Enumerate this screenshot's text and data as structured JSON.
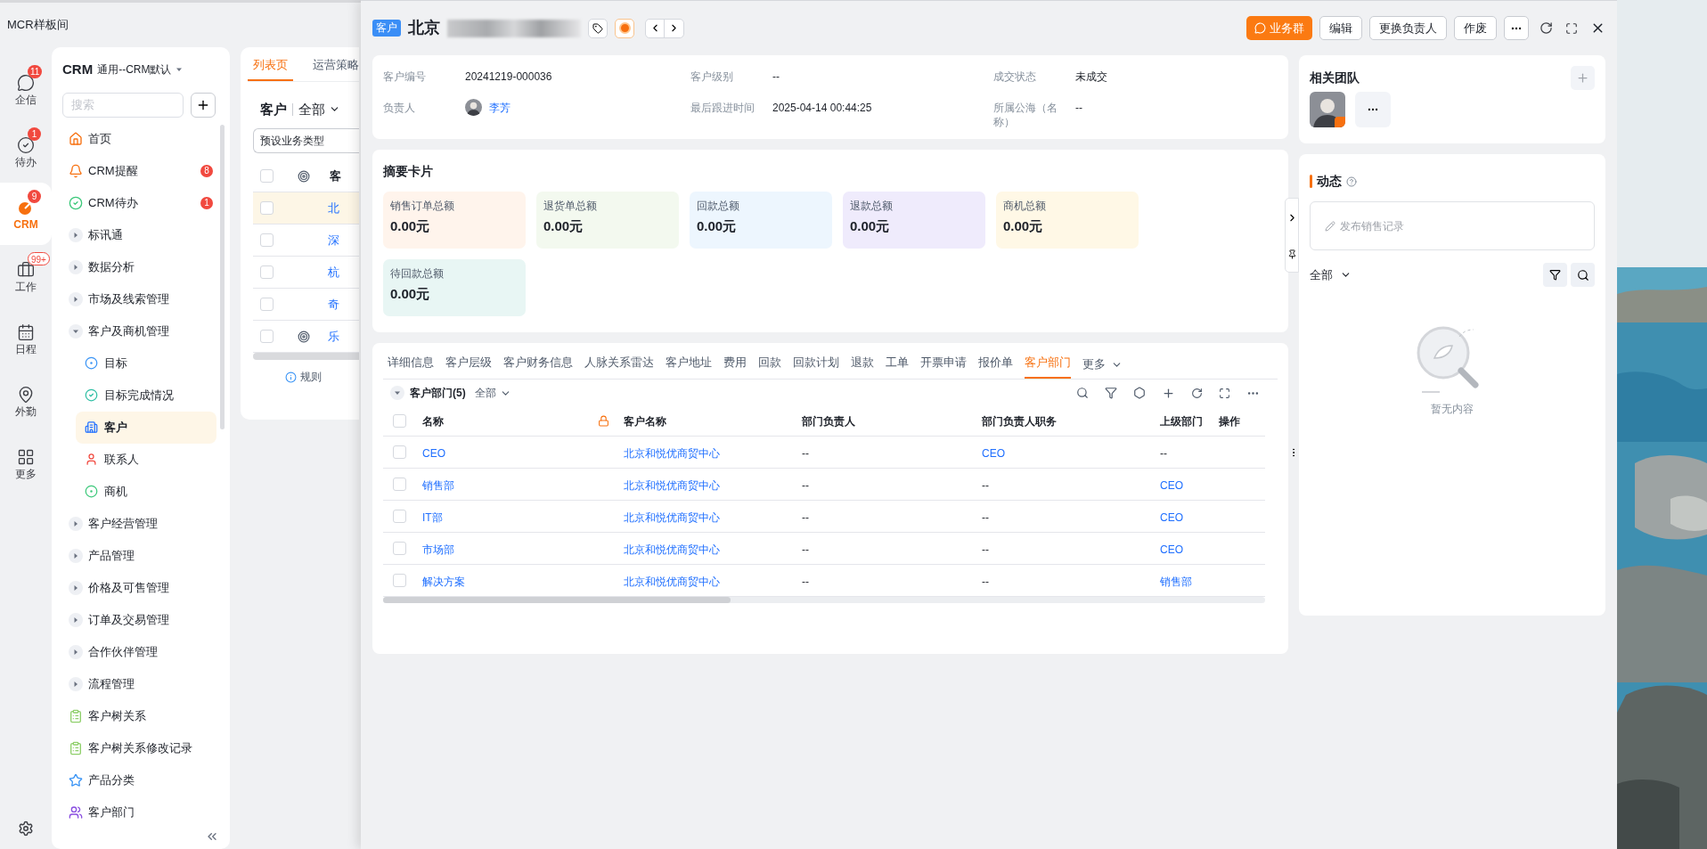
{
  "app_title": "MCR样板间",
  "rail": [
    {
      "label": "企信",
      "badge": "11",
      "badge_outlined": false,
      "selected": false
    },
    {
      "label": "待办",
      "badge": "1",
      "badge_outlined": false,
      "selected": false
    },
    {
      "label": "CRM",
      "badge": "9",
      "badge_outlined": false,
      "selected": true
    },
    {
      "label": "工作",
      "badge": "99+",
      "badge_outlined": true,
      "selected": false
    },
    {
      "label": "日程",
      "selected": false
    },
    {
      "label": "外勤",
      "selected": false
    },
    {
      "label": "更多",
      "selected": false
    }
  ],
  "nav": {
    "title": "CRM",
    "subtitle": "通用--CRM默认",
    "search_placeholder": "搜索",
    "items": [
      {
        "kind": "link",
        "label": "首页",
        "selected": false
      },
      {
        "kind": "link",
        "label": "CRM提醒",
        "badge": "8",
        "selected": false
      },
      {
        "kind": "link",
        "label": "CRM待办",
        "badge": "1",
        "selected": false
      },
      {
        "kind": "group",
        "label": "标讯通",
        "expanded": false,
        "selected": false
      },
      {
        "kind": "group",
        "label": "数据分析",
        "expanded": false,
        "selected": false
      },
      {
        "kind": "group",
        "label": "市场及线索管理",
        "expanded": false,
        "selected": false
      },
      {
        "kind": "group",
        "label": "客户及商机管理",
        "expanded": true,
        "selected": false,
        "children": [
          {
            "label": "目标",
            "selected": false
          },
          {
            "label": "目标完成情况",
            "selected": false
          },
          {
            "label": "客户",
            "selected": true
          },
          {
            "label": "联系人",
            "selected": false
          },
          {
            "label": "商机",
            "selected": false
          }
        ]
      },
      {
        "kind": "group",
        "label": "客户经营管理",
        "expanded": false,
        "selected": false
      },
      {
        "kind": "group",
        "label": "产品管理",
        "expanded": false,
        "selected": false
      },
      {
        "kind": "group",
        "label": "价格及可售管理",
        "expanded": false,
        "selected": false
      },
      {
        "kind": "group",
        "label": "订单及交易管理",
        "expanded": false,
        "selected": false
      },
      {
        "kind": "group",
        "label": "合作伙伴管理",
        "expanded": false,
        "selected": false
      },
      {
        "kind": "group",
        "label": "流程管理",
        "expanded": false,
        "selected": false
      },
      {
        "kind": "link",
        "label": "客户树关系",
        "selected": false
      },
      {
        "kind": "link",
        "label": "客户树关系修改记录",
        "selected": false
      },
      {
        "kind": "link",
        "label": "产品分类",
        "selected": false
      },
      {
        "kind": "link",
        "label": "客户部门",
        "selected": false
      }
    ]
  },
  "list_panel": {
    "tabs": [
      {
        "label": "列表页",
        "selected": true
      },
      {
        "label": "运营策略",
        "selected": false
      }
    ],
    "all_checked": false,
    "object": "客户",
    "scope": "全部",
    "type_filter": "预设业务类型",
    "header_column": "客",
    "rows": [
      {
        "name": "北",
        "selected": true,
        "checked": false,
        "marked": false
      },
      {
        "name": "深",
        "selected": false,
        "checked": false,
        "marked": false
      },
      {
        "name": "杭",
        "selected": false,
        "checked": false,
        "marked": false
      },
      {
        "name": "奇",
        "selected": false,
        "checked": false,
        "marked": false
      },
      {
        "name": "乐",
        "selected": false,
        "checked": false,
        "marked": true
      }
    ],
    "footer": "规则"
  },
  "drawer": {
    "badge": "客户",
    "title": "北京",
    "actions": [
      {
        "label": "业务群",
        "kind": "primary"
      },
      {
        "label": "编辑",
        "kind": "default"
      },
      {
        "label": "更换负责人",
        "kind": "default"
      },
      {
        "label": "作废",
        "kind": "default"
      }
    ],
    "info": [
      {
        "label": "客户编号",
        "value": "20241219-000036",
        "kind": "text"
      },
      {
        "label": "客户级别",
        "value": "--",
        "kind": "text"
      },
      {
        "label": "成交状态",
        "value": "未成交",
        "kind": "text"
      },
      {
        "label": "负责人",
        "value": "李芳",
        "kind": "person"
      },
      {
        "label": "最后跟进时间",
        "value": "2025-04-14 00:44:25",
        "kind": "text"
      },
      {
        "label": "所属公海（名称）",
        "value": "--",
        "kind": "text"
      }
    ],
    "summary": {
      "title": "摘要卡片",
      "cards": [
        {
          "label": "销售订单总额",
          "value": "0.00元",
          "color": "#fff4ec"
        },
        {
          "label": "退货单总额",
          "value": "0.00元",
          "color": "#f3f9ef"
        },
        {
          "label": "回款总额",
          "value": "0.00元",
          "color": "#edf6fe"
        },
        {
          "label": "退款总额",
          "value": "0.00元",
          "color": "#efebfc"
        },
        {
          "label": "商机总额",
          "value": "0.00元",
          "color": "#fff8e6"
        },
        {
          "label": "待回款总额",
          "value": "0.00元",
          "color": "#e8f6f4"
        }
      ]
    },
    "tabs": [
      {
        "label": "详细信息",
        "selected": false
      },
      {
        "label": "客户层级",
        "selected": false
      },
      {
        "label": "客户财务信息",
        "selected": false
      },
      {
        "label": "人脉关系雷达",
        "selected": false
      },
      {
        "label": "客户地址",
        "selected": false
      },
      {
        "label": "费用",
        "selected": false
      },
      {
        "label": "回款",
        "selected": false
      },
      {
        "label": "回款计划",
        "selected": false
      },
      {
        "label": "退款",
        "selected": false
      },
      {
        "label": "工单",
        "selected": false
      },
      {
        "label": "开票申请",
        "selected": false
      },
      {
        "label": "报价单",
        "selected": false
      },
      {
        "label": "客户部门",
        "selected": true
      }
    ],
    "more_tab": "更多",
    "section": {
      "title": "客户部门(5)",
      "scope": "全部",
      "expanded": true
    },
    "table": {
      "all_checked": false,
      "columns": [
        {
          "label": "名称",
          "locked": true
        },
        {
          "label": "客户名称",
          "locked": false
        },
        {
          "label": "部门负责人",
          "locked": false
        },
        {
          "label": "部门负责人职务",
          "locked": false
        },
        {
          "label": "上级部门",
          "locked": false
        },
        {
          "label": "操作",
          "locked": false
        }
      ],
      "rows": [
        {
          "checked": false,
          "cells": [
            {
              "text": "CEO",
              "link": true
            },
            {
              "text": "北京和悦优商贸中心",
              "link": true
            },
            {
              "text": "--",
              "link": false
            },
            {
              "text": "CEO",
              "link": true
            },
            {
              "text": "--",
              "link": false
            }
          ]
        },
        {
          "checked": false,
          "cells": [
            {
              "text": "销售部",
              "link": true
            },
            {
              "text": "北京和悦优商贸中心",
              "link": true
            },
            {
              "text": "--",
              "link": false
            },
            {
              "text": "--",
              "link": false
            },
            {
              "text": "CEO",
              "link": true
            }
          ]
        },
        {
          "checked": false,
          "cells": [
            {
              "text": "IT部",
              "link": true
            },
            {
              "text": "北京和悦优商贸中心",
              "link": true
            },
            {
              "text": "--",
              "link": false
            },
            {
              "text": "--",
              "link": false
            },
            {
              "text": "CEO",
              "link": true
            }
          ]
        },
        {
          "checked": false,
          "cells": [
            {
              "text": "市场部",
              "link": true
            },
            {
              "text": "北京和悦优商贸中心",
              "link": true
            },
            {
              "text": "--",
              "link": false
            },
            {
              "text": "--",
              "link": false
            },
            {
              "text": "CEO",
              "link": true
            }
          ]
        },
        {
          "checked": false,
          "cells": [
            {
              "text": "解决方案",
              "link": true
            },
            {
              "text": "北京和悦优商贸中心",
              "link": true
            },
            {
              "text": "--",
              "link": false
            },
            {
              "text": "--",
              "link": false
            },
            {
              "text": "销售部",
              "link": true
            }
          ]
        }
      ]
    }
  },
  "team": {
    "title": "相关团队"
  },
  "dynamics": {
    "title": "动态",
    "placeholder": "发布销售记录",
    "scope": "全部",
    "empty": "暂无内容"
  }
}
